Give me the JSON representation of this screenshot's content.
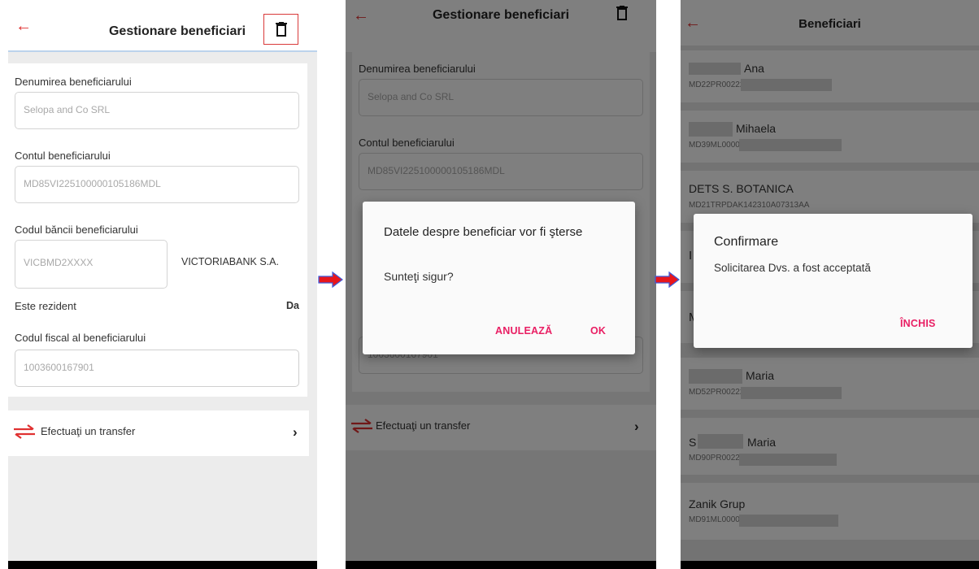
{
  "screen1": {
    "title": "Gestionare beneficiari",
    "fields": {
      "name_label": "Denumirea beneficiarului",
      "name_value": "Selopa and Co SRL",
      "account_label": "Contul beneficiarului",
      "account_value": "MD85VI225100000105186MDL",
      "bank_code_label": "Codul băncii beneficiarului",
      "bank_code_value": "VICBMD2XXXX",
      "bank_name": "VICTORIABANK S.A.",
      "resident_label": "Este rezident",
      "resident_value": "Da",
      "fiscal_label": "Codul fiscal al beneficiarului",
      "fiscal_value": "1003600167901"
    },
    "transfer_label": "Efectuaţi un transfer"
  },
  "screen2": {
    "title": "Gestionare beneficiari",
    "fields": {
      "name_label": "Denumirea beneficiarului",
      "name_value": "Selopa and Co SRL",
      "account_label": "Contul beneficiarului",
      "account_value": "MD85VI225100000105186MDL",
      "fiscal_value": "1003600167901"
    },
    "transfer_label": "Efectuaţi un transfer",
    "dialog": {
      "title": "Datele despre beneficiar vor fi şterse",
      "text": "Sunteţi sigur?",
      "cancel": "ANULEAZĂ",
      "ok": "OK"
    }
  },
  "screen3": {
    "title": "Beneficiari",
    "rows": [
      {
        "name": "Ana",
        "account": "MD22PR002225"
      },
      {
        "name": "Mihaela",
        "account": "MD39ML00000"
      },
      {
        "name": "DETS S. BOTANICA",
        "account": "MD21TRPDAK142310A07313AA"
      },
      {
        "name": "",
        "account": ""
      },
      {
        "name": "Maria",
        "account": "MD52PR00222"
      },
      {
        "name": "Maria",
        "account": "MD90PR002225"
      },
      {
        "name": "Zanik Grup",
        "account": "MD91ML00000"
      }
    ],
    "partial_initial_4": "I",
    "partial_initial_5": "M",
    "partial_initial_6": "S",
    "dialog": {
      "title": "Confirmare",
      "text": "Solicitarea Dvs. a fost acceptată",
      "close": "ÎNCHIS"
    }
  },
  "colors": {
    "accent_red": "#e03131",
    "dialog_button": "#e91e63",
    "flow_arrow": "#e8161b"
  },
  "icons": {
    "back": "arrow-left-icon",
    "delete": "trash-icon",
    "transfer": "transfer-arrows-icon",
    "chevron": "chevron-right-icon"
  }
}
